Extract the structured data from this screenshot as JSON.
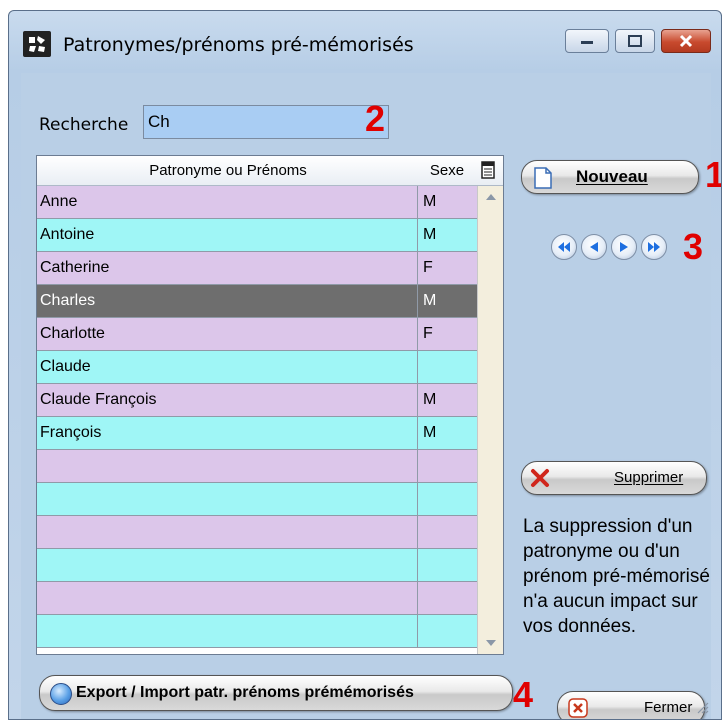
{
  "window": {
    "title": "Patronymes/prénoms pré-mémorisés"
  },
  "search": {
    "label": "Recherche",
    "value": "Ch"
  },
  "markers": {
    "search": "2",
    "new": "1",
    "nav": "3",
    "export": "4"
  },
  "table": {
    "columns": [
      "Patronyme ou Prénoms",
      "Sexe"
    ],
    "rows": [
      {
        "name": "Anne",
        "sex": "M"
      },
      {
        "name": "Antoine",
        "sex": "M"
      },
      {
        "name": "Catherine",
        "sex": "F"
      },
      {
        "name": "Charles",
        "sex": "M"
      },
      {
        "name": "Charlotte",
        "sex": "F"
      },
      {
        "name": "Claude",
        "sex": ""
      },
      {
        "name": "Claude François",
        "sex": "M"
      },
      {
        "name": "François",
        "sex": "M"
      },
      {
        "name": "",
        "sex": ""
      },
      {
        "name": "",
        "sex": ""
      },
      {
        "name": "",
        "sex": ""
      },
      {
        "name": "",
        "sex": ""
      },
      {
        "name": "",
        "sex": ""
      },
      {
        "name": "",
        "sex": ""
      }
    ],
    "selected_row": "Charles"
  },
  "buttons": {
    "new": "Nouveau",
    "delete": "Supprimer",
    "export": "Export / Import patr. prénoms prémémorisés",
    "close": "Fermer"
  },
  "info_text": "La suppression d'un patronyme ou d'un prénom pré-mémorisé n'a aucun impact sur vos données.",
  "colors": {
    "row_pink": "#dcc6ea",
    "row_cyan": "#9ff6f6",
    "row_selected": "#6e6e6e",
    "marker_red": "#e00000",
    "search_bg": "#a9cdf3"
  }
}
